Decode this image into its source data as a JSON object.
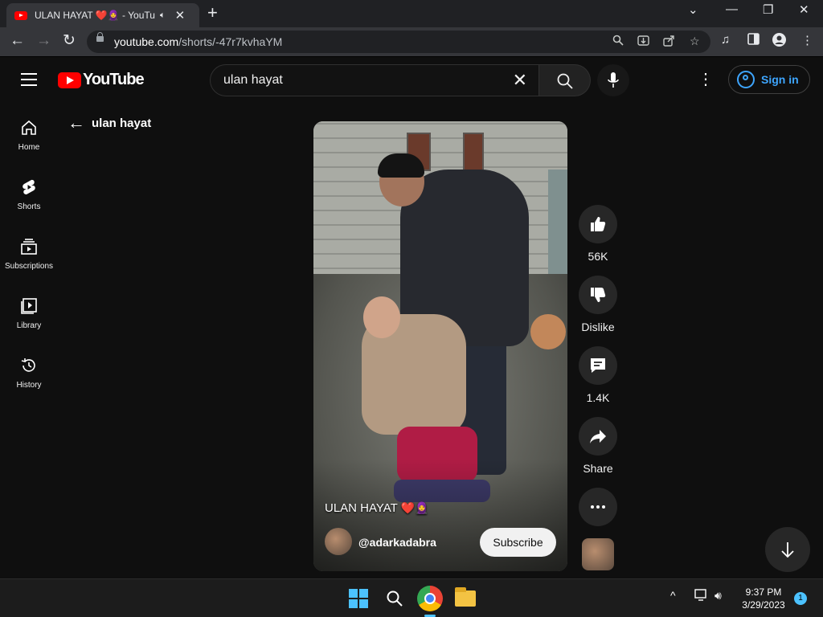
{
  "browser": {
    "tab_title": "ULAN HAYAT ❤️🧕 - YouTube",
    "new_tab_icon": "plus-icon",
    "url_host": "youtube.com",
    "url_path": "/shorts/-47r7kvhaYM"
  },
  "header": {
    "logo_text": "YouTube",
    "search_query": "ulan hayat",
    "sign_in": "Sign in"
  },
  "sidebar": {
    "items": [
      {
        "label": "Home",
        "icon": "home-icon"
      },
      {
        "label": "Shorts",
        "icon": "shorts-icon"
      },
      {
        "label": "Subscriptions",
        "icon": "subscriptions-icon"
      },
      {
        "label": "Library",
        "icon": "library-icon"
      },
      {
        "label": "History",
        "icon": "history-icon"
      }
    ]
  },
  "back_link": {
    "query": "ulan hayat"
  },
  "short": {
    "caption": "ULAN HAYAT",
    "caption_emoji": "❤️🧕",
    "channel": "@adarkadabra",
    "subscribe_label": "Subscribe"
  },
  "actions": {
    "like_count": "56K",
    "dislike_label": "Dislike",
    "comments_count": "1.4K",
    "share_label": "Share"
  },
  "taskbar": {
    "time": "9:37 PM",
    "date": "3/29/2023",
    "notification_count": "1",
    "accent": "#4cc2ff"
  },
  "colors": {
    "youtube_red": "#ff0000",
    "link_blue": "#3ea6ff",
    "background": "#0f0f0f"
  }
}
